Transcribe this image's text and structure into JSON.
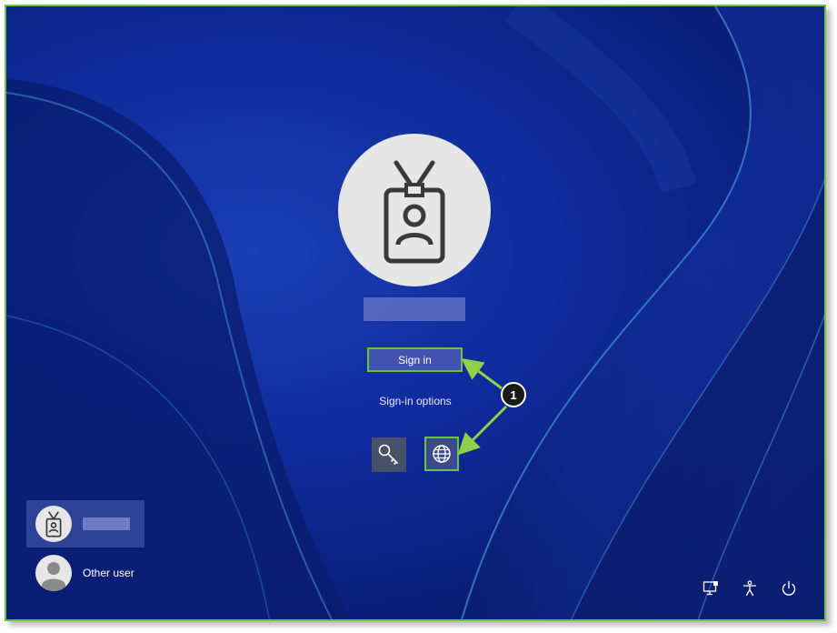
{
  "login": {
    "sign_in_label": "Sign in",
    "sign_in_options_label": "Sign-in options"
  },
  "callout": {
    "number": "1"
  },
  "users": {
    "other_user_label": "Other user"
  },
  "system": {
    "icons": [
      "network-icon",
      "accessibility-icon",
      "power-icon"
    ]
  },
  "colors": {
    "highlight": "#6cc04a",
    "background": "#0f2a9a",
    "button": "#4253b0"
  }
}
